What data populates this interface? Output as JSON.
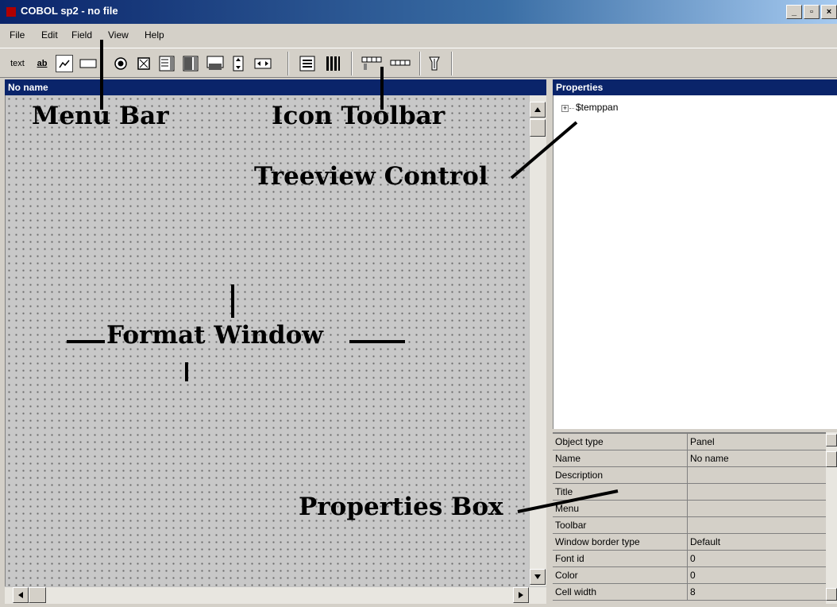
{
  "window": {
    "title": "COBOL sp2 - no file",
    "min_label": "_",
    "max_label": "▫",
    "close_label": "×"
  },
  "menubar": {
    "items": [
      "File",
      "Edit",
      "Field",
      "View",
      "Help"
    ]
  },
  "toolbar": {
    "text_label": "text",
    "edit_label": "ab"
  },
  "format_window": {
    "header": "No name"
  },
  "properties_panel": {
    "header": "Properties",
    "tree": {
      "root_label": "$temppan",
      "expander": "+"
    },
    "rows": [
      {
        "name": "Object type",
        "value": "Panel"
      },
      {
        "name": "Name",
        "value": "No name"
      },
      {
        "name": "Description",
        "value": ""
      },
      {
        "name": "Title",
        "value": ""
      },
      {
        "name": "Menu",
        "value": ""
      },
      {
        "name": "Toolbar",
        "value": ""
      },
      {
        "name": "Window border type",
        "value": "Default"
      },
      {
        "name": "Font id",
        "value": "0"
      },
      {
        "name": "Color",
        "value": "0"
      },
      {
        "name": "Cell width",
        "value": "8"
      }
    ]
  },
  "annotations": {
    "menu_bar": "Menu Bar",
    "icon_toolbar": "Icon Toolbar",
    "treeview_control": "Treeview Control",
    "format_window": "Format Window",
    "properties_box": "Properties Box"
  }
}
